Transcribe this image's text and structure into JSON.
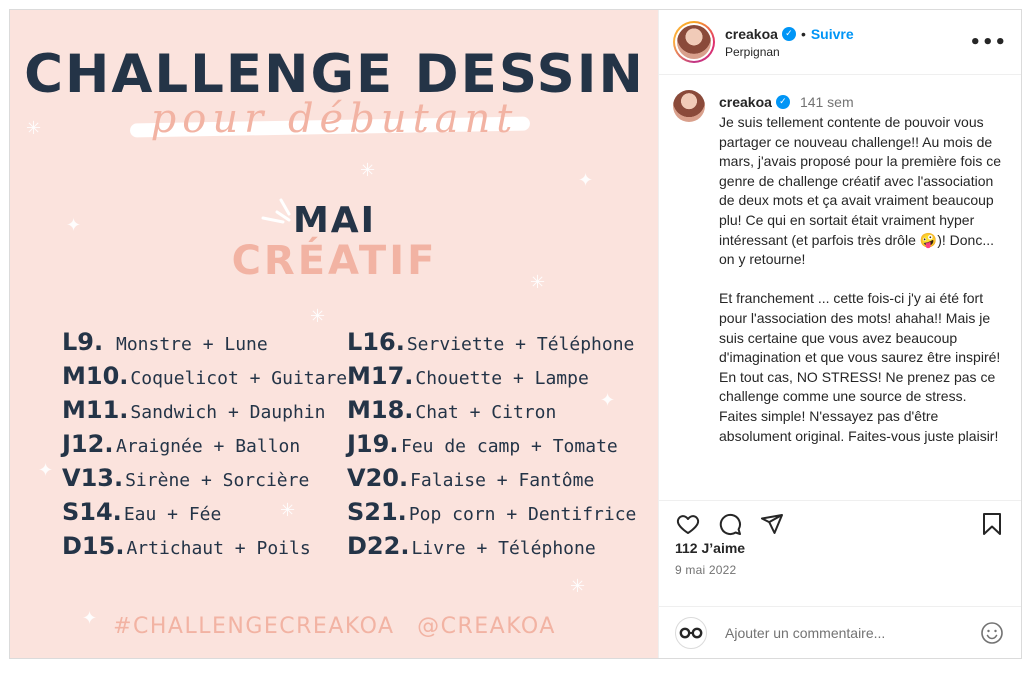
{
  "image": {
    "title": "CHALLENGE DESSIN",
    "subtitle": "pour débutant",
    "month_line1": "MAI",
    "month_line2": "CRÉATIF",
    "days_col1": [
      {
        "day": "L9.",
        "words": "Monstre + Lune"
      },
      {
        "day": "M10.",
        "words": "Coquelicot + Guitare"
      },
      {
        "day": "M11.",
        "words": "Sandwich + Dauphin"
      },
      {
        "day": "J12.",
        "words": "Araignée + Ballon"
      },
      {
        "day": "V13.",
        "words": "Sirène + Sorcière"
      },
      {
        "day": "S14.",
        "words": "Eau + Fée"
      },
      {
        "day": "D15.",
        "words": "Artichaut + Poils"
      }
    ],
    "days_col2": [
      {
        "day": "L16.",
        "words": "Serviette + Téléphone"
      },
      {
        "day": "M17.",
        "words": "Chouette + Lampe"
      },
      {
        "day": "M18.",
        "words": "Chat + Citron"
      },
      {
        "day": "J19.",
        "words": "Feu de camp + Tomate"
      },
      {
        "day": "V20.",
        "words": "Falaise + Fantôme"
      },
      {
        "day": "S21.",
        "words": "Pop corn + Dentifrice"
      },
      {
        "day": "D22.",
        "words": "Livre + Téléphone"
      }
    ],
    "hashtag": "#CHALLENGECREAKOA",
    "handle": "@CREAKOA"
  },
  "header": {
    "username": "creakoa",
    "separator": "•",
    "follow_label": "Suivre",
    "location": "Perpignan",
    "more_label": "•••"
  },
  "caption": {
    "username": "creakoa",
    "time": "141 sem",
    "text": "Je suis tellement contente de pouvoir vous partager ce nouveau challenge!! Au mois de mars, j'avais proposé pour la première fois ce genre de challenge créatif avec l'association de deux mots et ça avait vraiment beaucoup plu! Ce qui en sortait était vraiment hyper intéressant (et parfois très drôle 🤪)! Donc... on y retourne!\n\nEt franchement ... cette fois-ci j'y ai été fort pour l'association des mots! ahaha!! Mais je suis certaine que vous avez beaucoup d'imagination et que vous saurez être inspiré! En tout cas, NO STRESS! Ne prenez pas ce challenge comme une source de stress. Faites simple! N'essayez pas d'être absolument original. Faites-vous juste plaisir!"
  },
  "stats": {
    "likes": "112 J’aime",
    "date": "9 mai 2022"
  },
  "comment": {
    "placeholder": "Ajouter un commentaire..."
  },
  "icons": {
    "like": "heart-icon",
    "comment": "comment-icon",
    "share": "share-icon",
    "save": "bookmark-icon",
    "emoji": "emoji-icon",
    "verified": "verified-badge-icon"
  },
  "colors": {
    "image_bg": "#fbe3dd",
    "navy": "#243447",
    "peach": "#f2b3a3",
    "link_blue": "#0095f6"
  }
}
